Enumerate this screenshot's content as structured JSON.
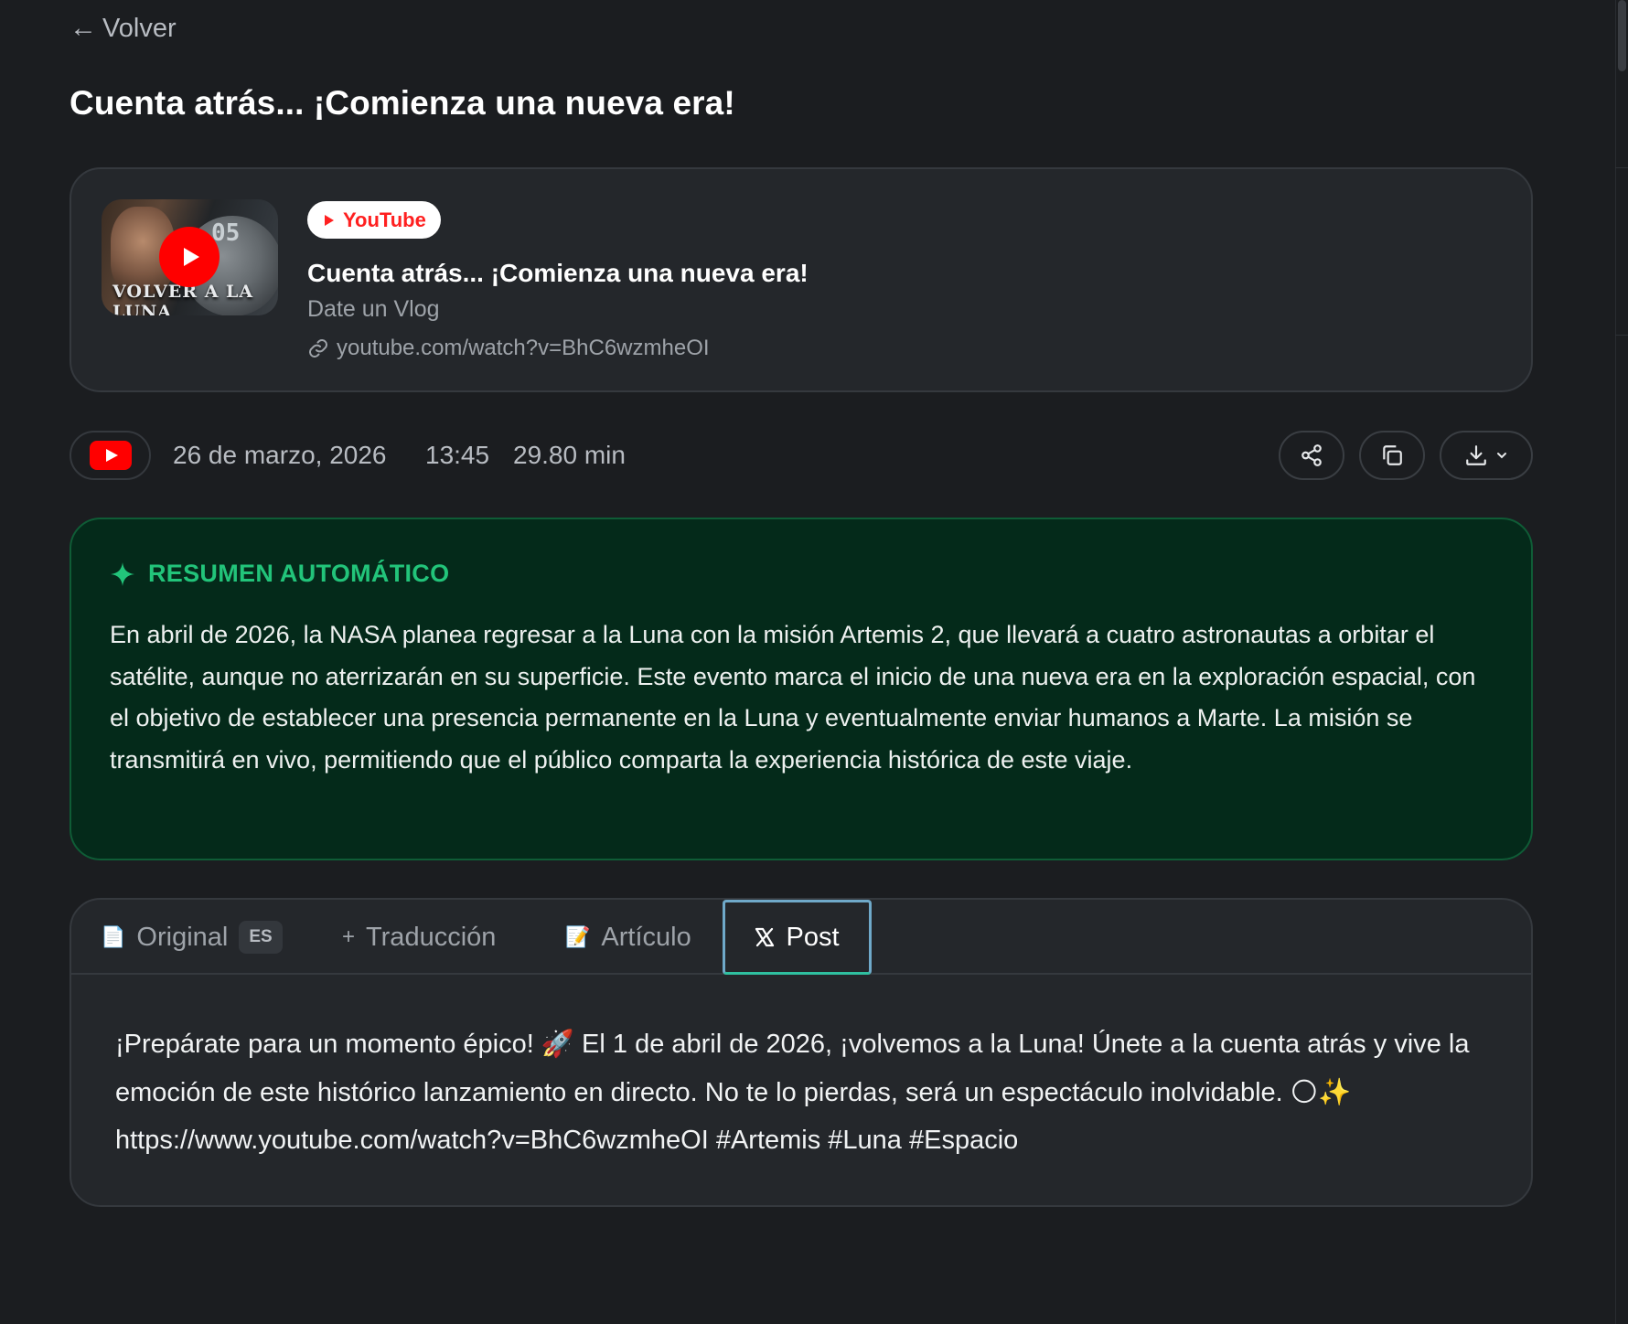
{
  "nav": {
    "back_label": "Volver"
  },
  "page": {
    "title": "Cuenta atrás... ¡Comienza una nueva era!"
  },
  "source_card": {
    "thumbnail": {
      "badge_text": "05",
      "caption": "VOLVER A LA LUNA"
    },
    "platform_label": "YouTube",
    "title": "Cuenta atrás... ¡Comienza una nueva era!",
    "channel": "Date un Vlog",
    "url": "youtube.com/watch?v=BhC6wzmheOI"
  },
  "meta": {
    "platform_icon": "youtube-icon",
    "date": "26 de marzo, 2026",
    "time": "13:45",
    "duration": "29.80 min",
    "actions": [
      "share-icon",
      "copy-icon",
      "download-icon"
    ]
  },
  "summary": {
    "heading": "RESUMEN AUTOMÁTICO",
    "text": "En abril de 2026, la NASA planea regresar a la Luna con la misión Artemis 2, que llevará a cuatro astronautas a orbitar el satélite, aunque no aterrizarán en su superficie. Este evento marca el inicio de una nueva era en la exploración espacial, con el objetivo de establecer una presencia permanente en la Luna y eventualmente enviar humanos a Marte. La misión se transmitirá en vivo, permitiendo que el público comparta la experiencia histórica de este viaje."
  },
  "tabs": {
    "items": [
      {
        "label": "Original",
        "icon": "📄",
        "badge": "ES"
      },
      {
        "label": "Traducción",
        "icon": "+"
      },
      {
        "label": "Artículo",
        "icon": "📝"
      },
      {
        "label": "Post",
        "icon": "X",
        "active": true
      }
    ]
  },
  "post": {
    "text": "¡Prepárate para un momento épico! 🚀 El 1 de abril de 2026, ¡volvemos a la Luna! Únete a la cuenta atrás y vive la emoción de este histórico lanzamiento en directo. No te lo pierdas, será un espectáculo inolvidable. 🌕✨ https://www.youtube.com/watch?v=BhC6wzmheOI #Artemis #Luna #Espacio"
  },
  "colors": {
    "background": "#1b1d20",
    "card": "#24272b",
    "summary_bg": "#042a1a",
    "summary_accent": "#22c47a",
    "youtube_red": "#ff0000",
    "active_tab_border": "#6fa9c9"
  }
}
